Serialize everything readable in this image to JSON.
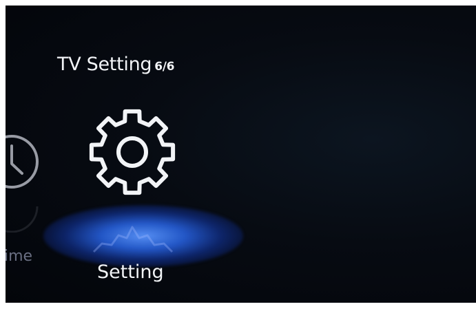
{
  "header": {
    "title": "TV Setting",
    "page_indicator": "6/6"
  },
  "menu": {
    "items": [
      {
        "label": "ime",
        "icon": "clock-icon",
        "selected": false
      },
      {
        "label": "Setting",
        "icon": "gear-icon",
        "selected": true
      }
    ]
  },
  "colors": {
    "background": "#05080f",
    "text": "#f2f4f7",
    "dim_text": "#6a6f82",
    "selection_glow": "#2f6ae8"
  }
}
